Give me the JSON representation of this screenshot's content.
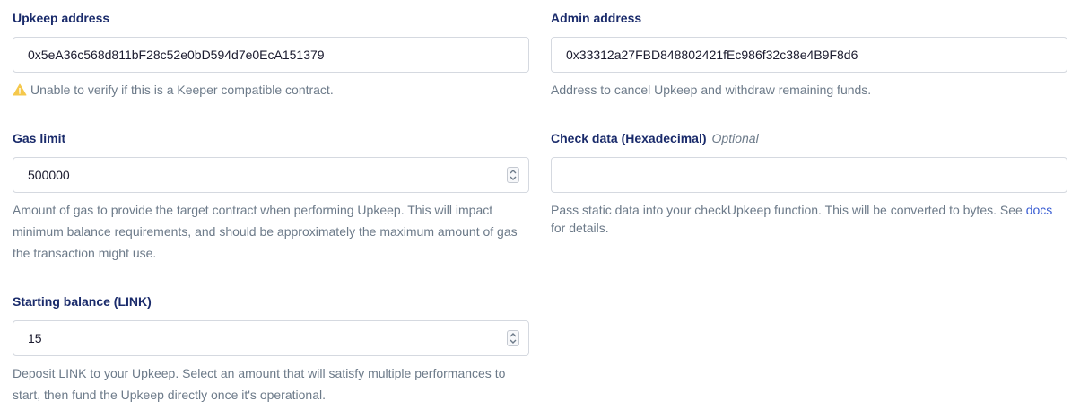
{
  "upkeep_address": {
    "label": "Upkeep address",
    "value": "0x5eA36c568d811bF28c52e0bD594d7e0EcA151379",
    "warning": "Unable to verify if this is a Keeper compatible contract."
  },
  "admin_address": {
    "label": "Admin address",
    "value": "0x33312a27FBD848802421fEc986f32c38e4B9F8d6",
    "help": "Address to cancel Upkeep and withdraw remaining funds."
  },
  "gas_limit": {
    "label": "Gas limit",
    "value": "500000",
    "help_line1": "Amount of gas to provide the target contract when performing Upkeep. This will impact",
    "help_line2": "minimum balance requirements, and should be approximately the maximum amount of gas",
    "help_line3": "the transaction might use."
  },
  "check_data": {
    "label": "Check data (Hexadecimal)",
    "optional": "Optional",
    "value": "",
    "help_line1": "Pass static data into your checkUpkeep function. This will be converted to bytes. See",
    "help_link": "docs",
    "help_line2": "for details."
  },
  "starting_balance": {
    "label": "Starting balance (LINK)",
    "value": "15",
    "help_line1": "Deposit LINK to your Upkeep. Select an amount that will satisfy multiple performances to",
    "help_line2": "start, then fund the Upkeep directly once it's operational."
  },
  "colors": {
    "label": "#1a2b6b",
    "help": "#6c7a89",
    "link": "#375bd2",
    "warning": "#f5c84c",
    "border": "#d5d9e0"
  }
}
